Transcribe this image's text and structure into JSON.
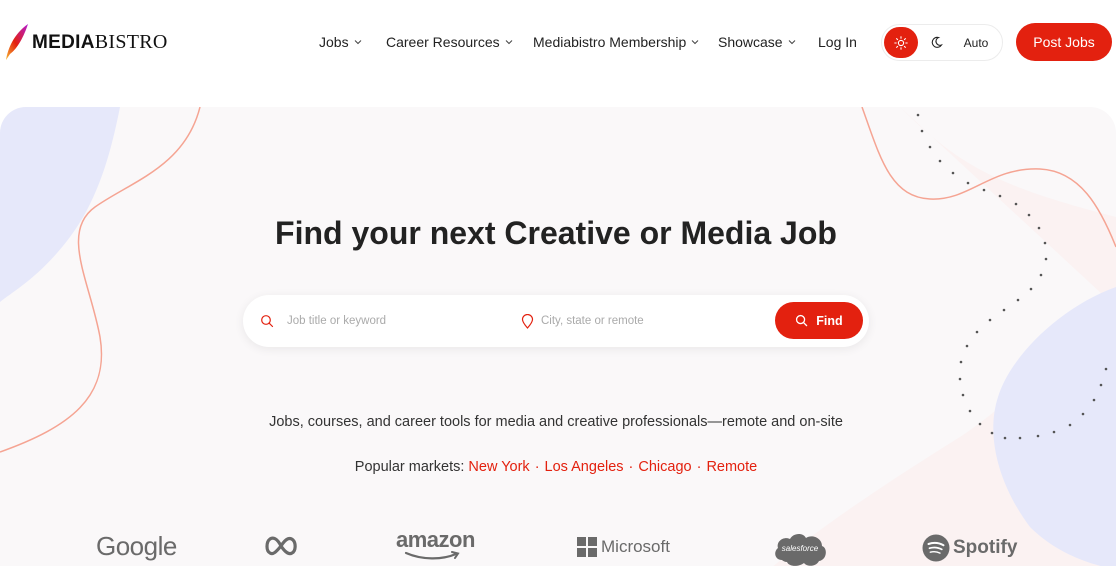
{
  "logo": {
    "bold": "MEDIA",
    "light": "BISTRO"
  },
  "nav": {
    "items": [
      {
        "label": "Jobs",
        "dropdown": true
      },
      {
        "label": "Career Resources",
        "dropdown": true
      },
      {
        "label": "Mediabistro Membership",
        "dropdown": true
      },
      {
        "label": "Showcase",
        "dropdown": true
      },
      {
        "label": "Log In",
        "dropdown": false
      }
    ]
  },
  "theme": {
    "selected": "light",
    "auto_label": "Auto"
  },
  "post_jobs_label": "Post Jobs",
  "hero": {
    "title_bold": "Find your next",
    "title_regular": "Creative or Media Job",
    "tagline": "Jobs, courses, and career tools for media and creative professionals—remote and on-site",
    "markets_label": "Popular markets:",
    "markets": [
      "New York",
      "Los Angeles",
      "Chicago",
      "Remote"
    ],
    "separator": "·"
  },
  "search": {
    "keyword_placeholder": "Job title or keyword",
    "keyword_value": "",
    "location_placeholder": "City, state or remote",
    "location_value": "",
    "find_label": "Find"
  },
  "brands": {
    "google": "Google",
    "amazon": "amazon",
    "microsoft": "Microsoft",
    "salesforce": "salesforce",
    "spotify": "Spotify"
  },
  "colors": {
    "accent": "#e3210f",
    "hero_bg": "#faf8f9",
    "deco_blue": "#e6e8fa",
    "deco_line": "#f5a493"
  }
}
